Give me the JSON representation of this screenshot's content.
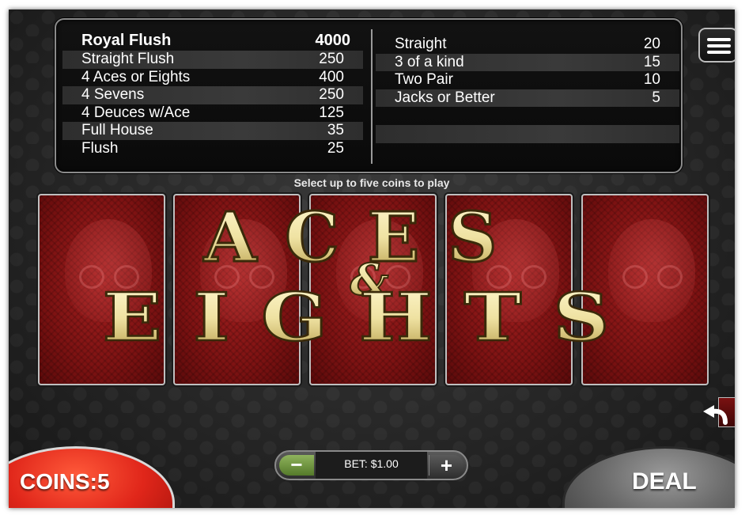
{
  "paytable": {
    "left": [
      {
        "name": "Royal Flush",
        "value": "4000"
      },
      {
        "name": "Straight Flush",
        "value": "250"
      },
      {
        "name": "4 Aces or Eights",
        "value": "400"
      },
      {
        "name": "4 Sevens",
        "value": "250"
      },
      {
        "name": "4 Deuces w/Ace",
        "value": "125"
      },
      {
        "name": "Full House",
        "value": "35"
      },
      {
        "name": "Flush",
        "value": "25"
      }
    ],
    "right": [
      {
        "name": "Straight",
        "value": "20"
      },
      {
        "name": "3 of a kind",
        "value": "15"
      },
      {
        "name": "Two Pair",
        "value": "10"
      },
      {
        "name": "Jacks or Better",
        "value": "5"
      }
    ]
  },
  "hint": "Select up to five coins to play",
  "logo": {
    "line1": "ACES",
    "amp": "&",
    "line2": "EIGHTS"
  },
  "coins": {
    "label": "COINS:5"
  },
  "bet": {
    "label": "BET: $1.00",
    "minus": "−",
    "plus": "+"
  },
  "deal": {
    "label": "DEAL"
  },
  "icons": {
    "menu": "hamburger-menu-icon",
    "undo": "undo-arrow-icon"
  },
  "colors": {
    "coins_button": "#e0261a",
    "minus_button": "#6f9a3f",
    "card_back": "#8c1616",
    "logo_gold": "#efe2a2"
  }
}
